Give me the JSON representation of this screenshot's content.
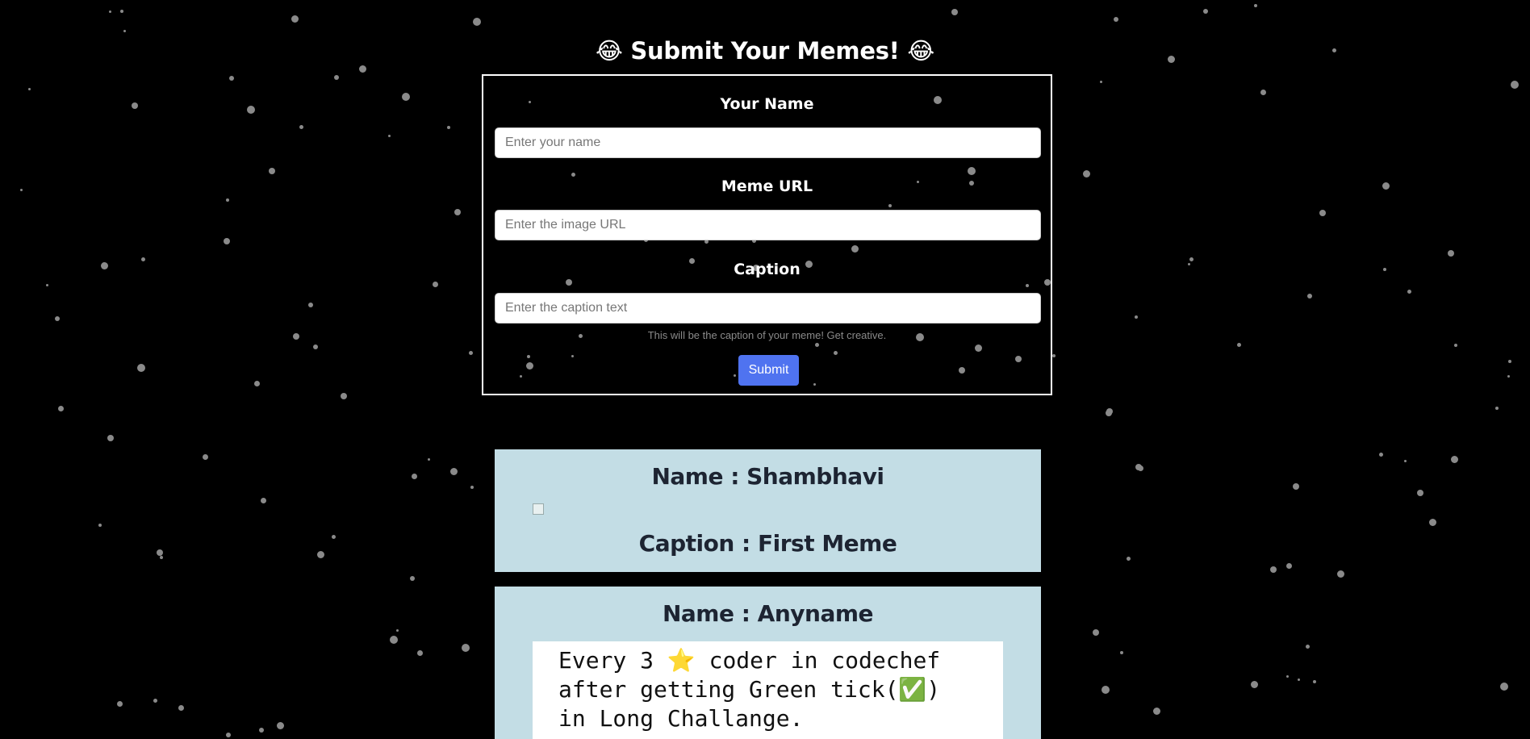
{
  "page": {
    "title": "😂 Submit Your Memes! 😂"
  },
  "form": {
    "name_label": "Your Name",
    "name_placeholder": "Enter your name",
    "name_value": "",
    "url_label": "Meme URL",
    "url_placeholder": "Enter the image URL",
    "url_value": "",
    "caption_label": "Caption",
    "caption_placeholder": "Enter the caption text",
    "caption_value": "",
    "caption_help": "This will be the caption of your meme! Get creative.",
    "submit_label": "Submit"
  },
  "memes": [
    {
      "name_heading": "Name : Shambhavi",
      "caption_heading": "Caption : First Meme"
    },
    {
      "name_heading": "Name : Anyname",
      "image_text": [
        "Every 3 ⭐ coder in codechef",
        "after getting Green tick(✅)",
        "in Long Challange."
      ]
    }
  ],
  "colors": {
    "background": "#000000",
    "star": "#8a8a8a",
    "card_background": "#c3dde5",
    "submit_button": "#4f73f0",
    "heading_text": "#1d2432"
  }
}
